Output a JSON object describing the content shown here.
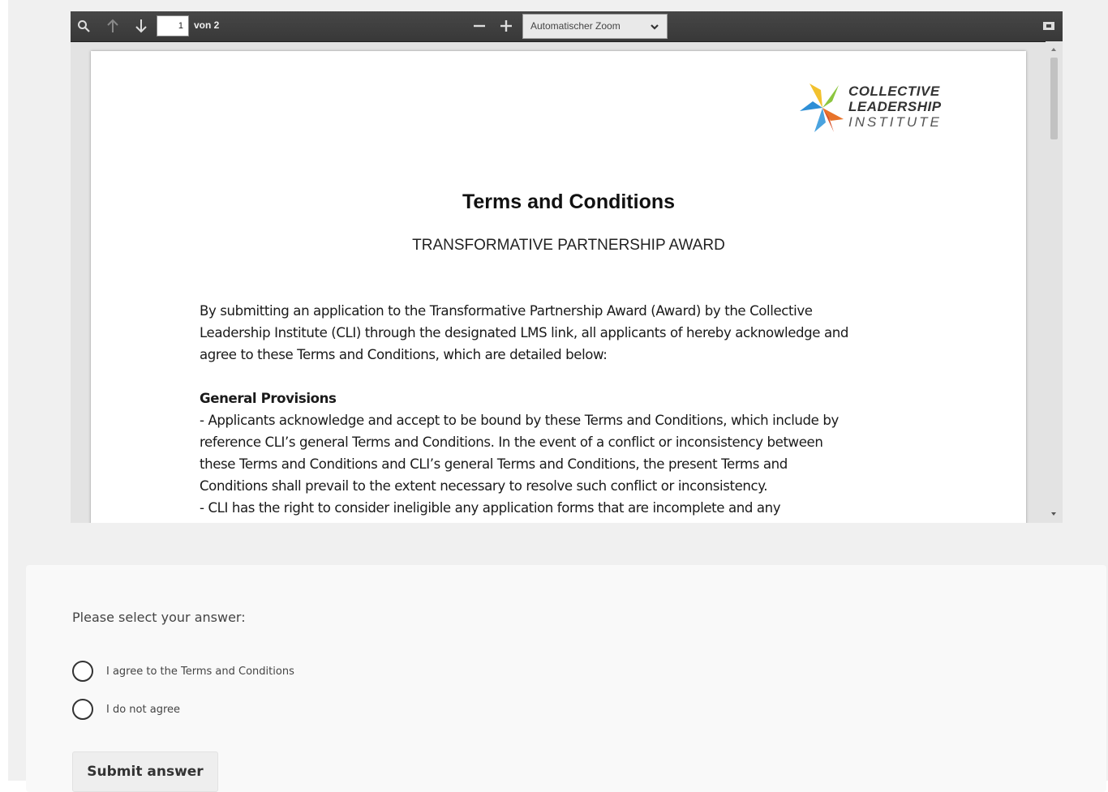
{
  "viewer": {
    "page_current": "1",
    "page_count": "von 2",
    "zoom_value": "Automatischer Zoom"
  },
  "logo": {
    "line1": "COLLECTIVE",
    "line2": "LEADERSHIP",
    "line3": "INSTITUTE"
  },
  "document": {
    "title": "Terms and Conditions",
    "subtitle": "TRANSFORMATIVE PARTNERSHIP AWARD",
    "intro_lines": [
      "By submitting an application to the Transformative Partnership Award (Award) by the Collective",
      "Leadership Institute (CLI) through the designated LMS link, all applicants of hereby acknowledge and",
      "agree to these Terms and Conditions, which are detailed below:"
    ],
    "section_heading": "General Provisions",
    "section_lines": [
      "- Applicants acknowledge and accept to be bound by these Terms and Conditions, which include by",
      "reference CLI’s general Terms and Conditions. In the event of a conflict or inconsistency between",
      "these Terms and Conditions and CLI’s general Terms and Conditions, the present Terms and",
      "Conditions shall prevail to the extent necessary to resolve such conflict or inconsistency.",
      "- CLI has the right to consider ineligible any application forms that are incomplete and any"
    ]
  },
  "answer": {
    "prompt": "Please select your answer:",
    "options": [
      "I agree to the Terms and Conditions",
      "I do not agree"
    ],
    "submit_label": "Submit answer"
  },
  "icons": [
    "search-icon",
    "arrow-up-icon",
    "arrow-down-icon",
    "zoom-out-icon",
    "zoom-in-icon",
    "chevron-down-icon",
    "presentation-mode-icon"
  ],
  "colors": {
    "toolbar": "#3c3c3c",
    "page_bg": "#ffffff",
    "card_bg": "#f9f9f9",
    "logo_yellow": "#f2c12e",
    "logo_green": "#8cc63f",
    "logo_blue": "#2e8fd6",
    "logo_orange": "#e8732a"
  }
}
